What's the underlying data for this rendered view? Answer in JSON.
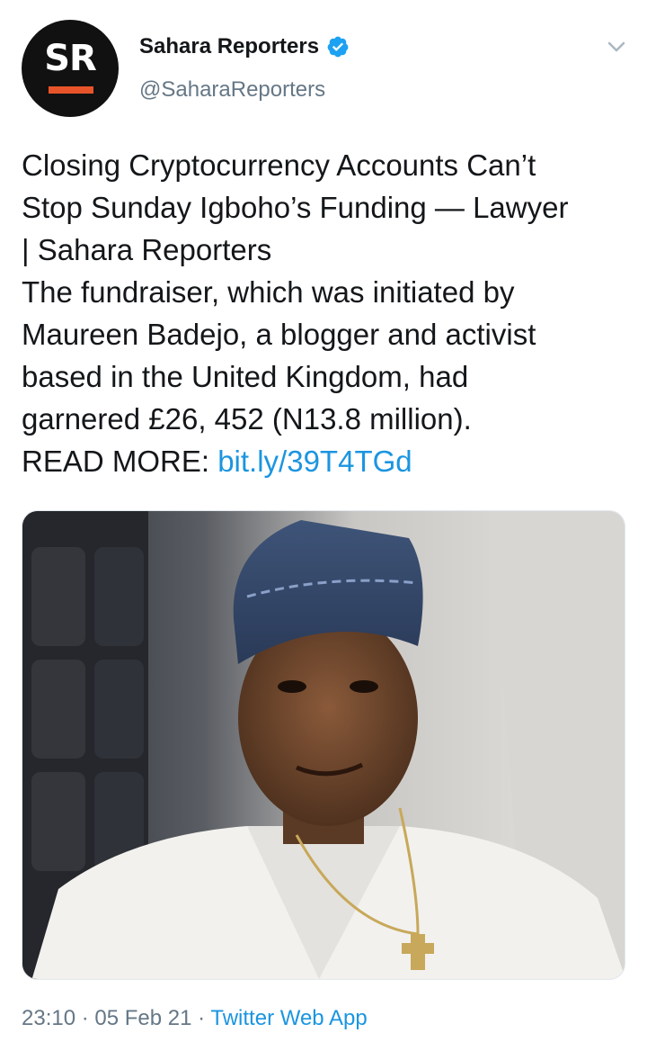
{
  "account": {
    "avatar_text": "SR",
    "name": "Sahara Reporters",
    "handle": "@SaharaReporters",
    "verified": true,
    "verified_icon": "verified-badge-icon",
    "menu_icon": "chevron-down-icon"
  },
  "tweet": {
    "lines": [
      "Closing Cryptocurrency Accounts Can’t",
      "Stop Sunday Igboho’s Funding — Lawyer",
      "| Sahara Reporters",
      "The fundraiser, which was initiated by",
      "Maureen Badejo, a blogger and activist",
      "based in the United Kingdom, had",
      "garnered £26, 452 (N13.8 million)."
    ],
    "read_more_label": "READ MORE: ",
    "link_text": "bit.ly/39T4TGd"
  },
  "media": {
    "description_icon": "photo-man-in-cap"
  },
  "footer": {
    "time": "23:10",
    "separator": " · ",
    "date": "05 Feb 21",
    "source": "Twitter Web App"
  },
  "colors": {
    "link": "#1b95e0",
    "muted": "#657786",
    "text": "#14171a",
    "avatar_bg": "#111111",
    "avatar_accent": "#e8542a",
    "verified": "#1da1f2"
  }
}
